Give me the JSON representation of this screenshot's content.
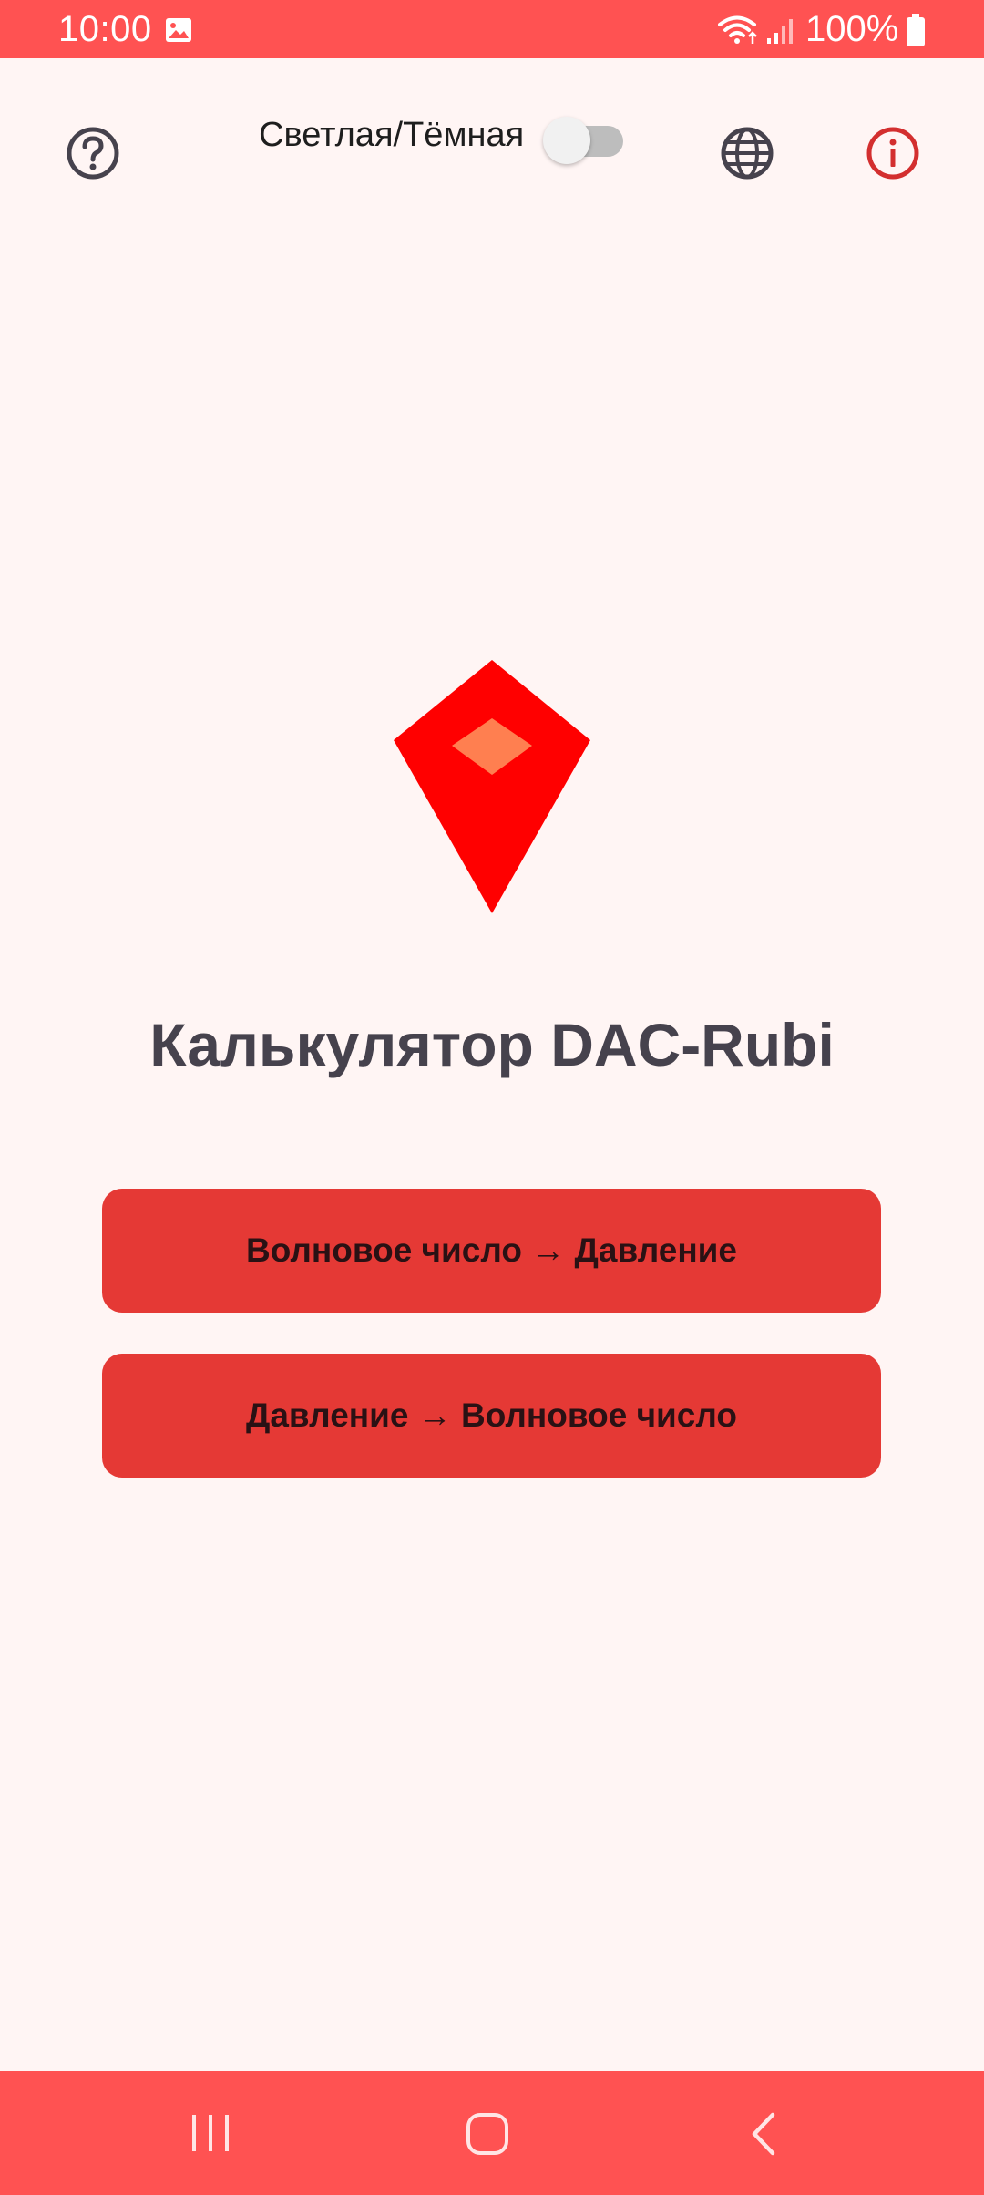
{
  "status_bar": {
    "time": "10:00",
    "battery": "100%",
    "icons": [
      "gallery-icon",
      "wifi-icon",
      "signal-icon",
      "battery-icon"
    ]
  },
  "top_bar": {
    "help_icon": "help-circle-icon",
    "theme_toggle_label": "Светлая/Тёмная",
    "theme_toggle_on": false,
    "language_icon": "globe-icon",
    "info_icon": "info-circle-icon"
  },
  "main": {
    "logo_icon": "ruby-gem-icon",
    "title": "Калькулятор DAC-Rubi",
    "buttons": {
      "wave_to_pressure": "Волновое число → Давление",
      "pressure_to_wave": "Давление → Волновое число"
    }
  },
  "nav_bar": {
    "icons": [
      "recents-icon",
      "home-icon",
      "back-icon"
    ]
  },
  "colors": {
    "accent": "#FF5252",
    "button": "#E53935",
    "background": "#FFF5F4",
    "title": "#46424D",
    "logo_red": "#FF0000",
    "logo_facet": "#FF7F50",
    "info_icon": "#D32F2F"
  }
}
